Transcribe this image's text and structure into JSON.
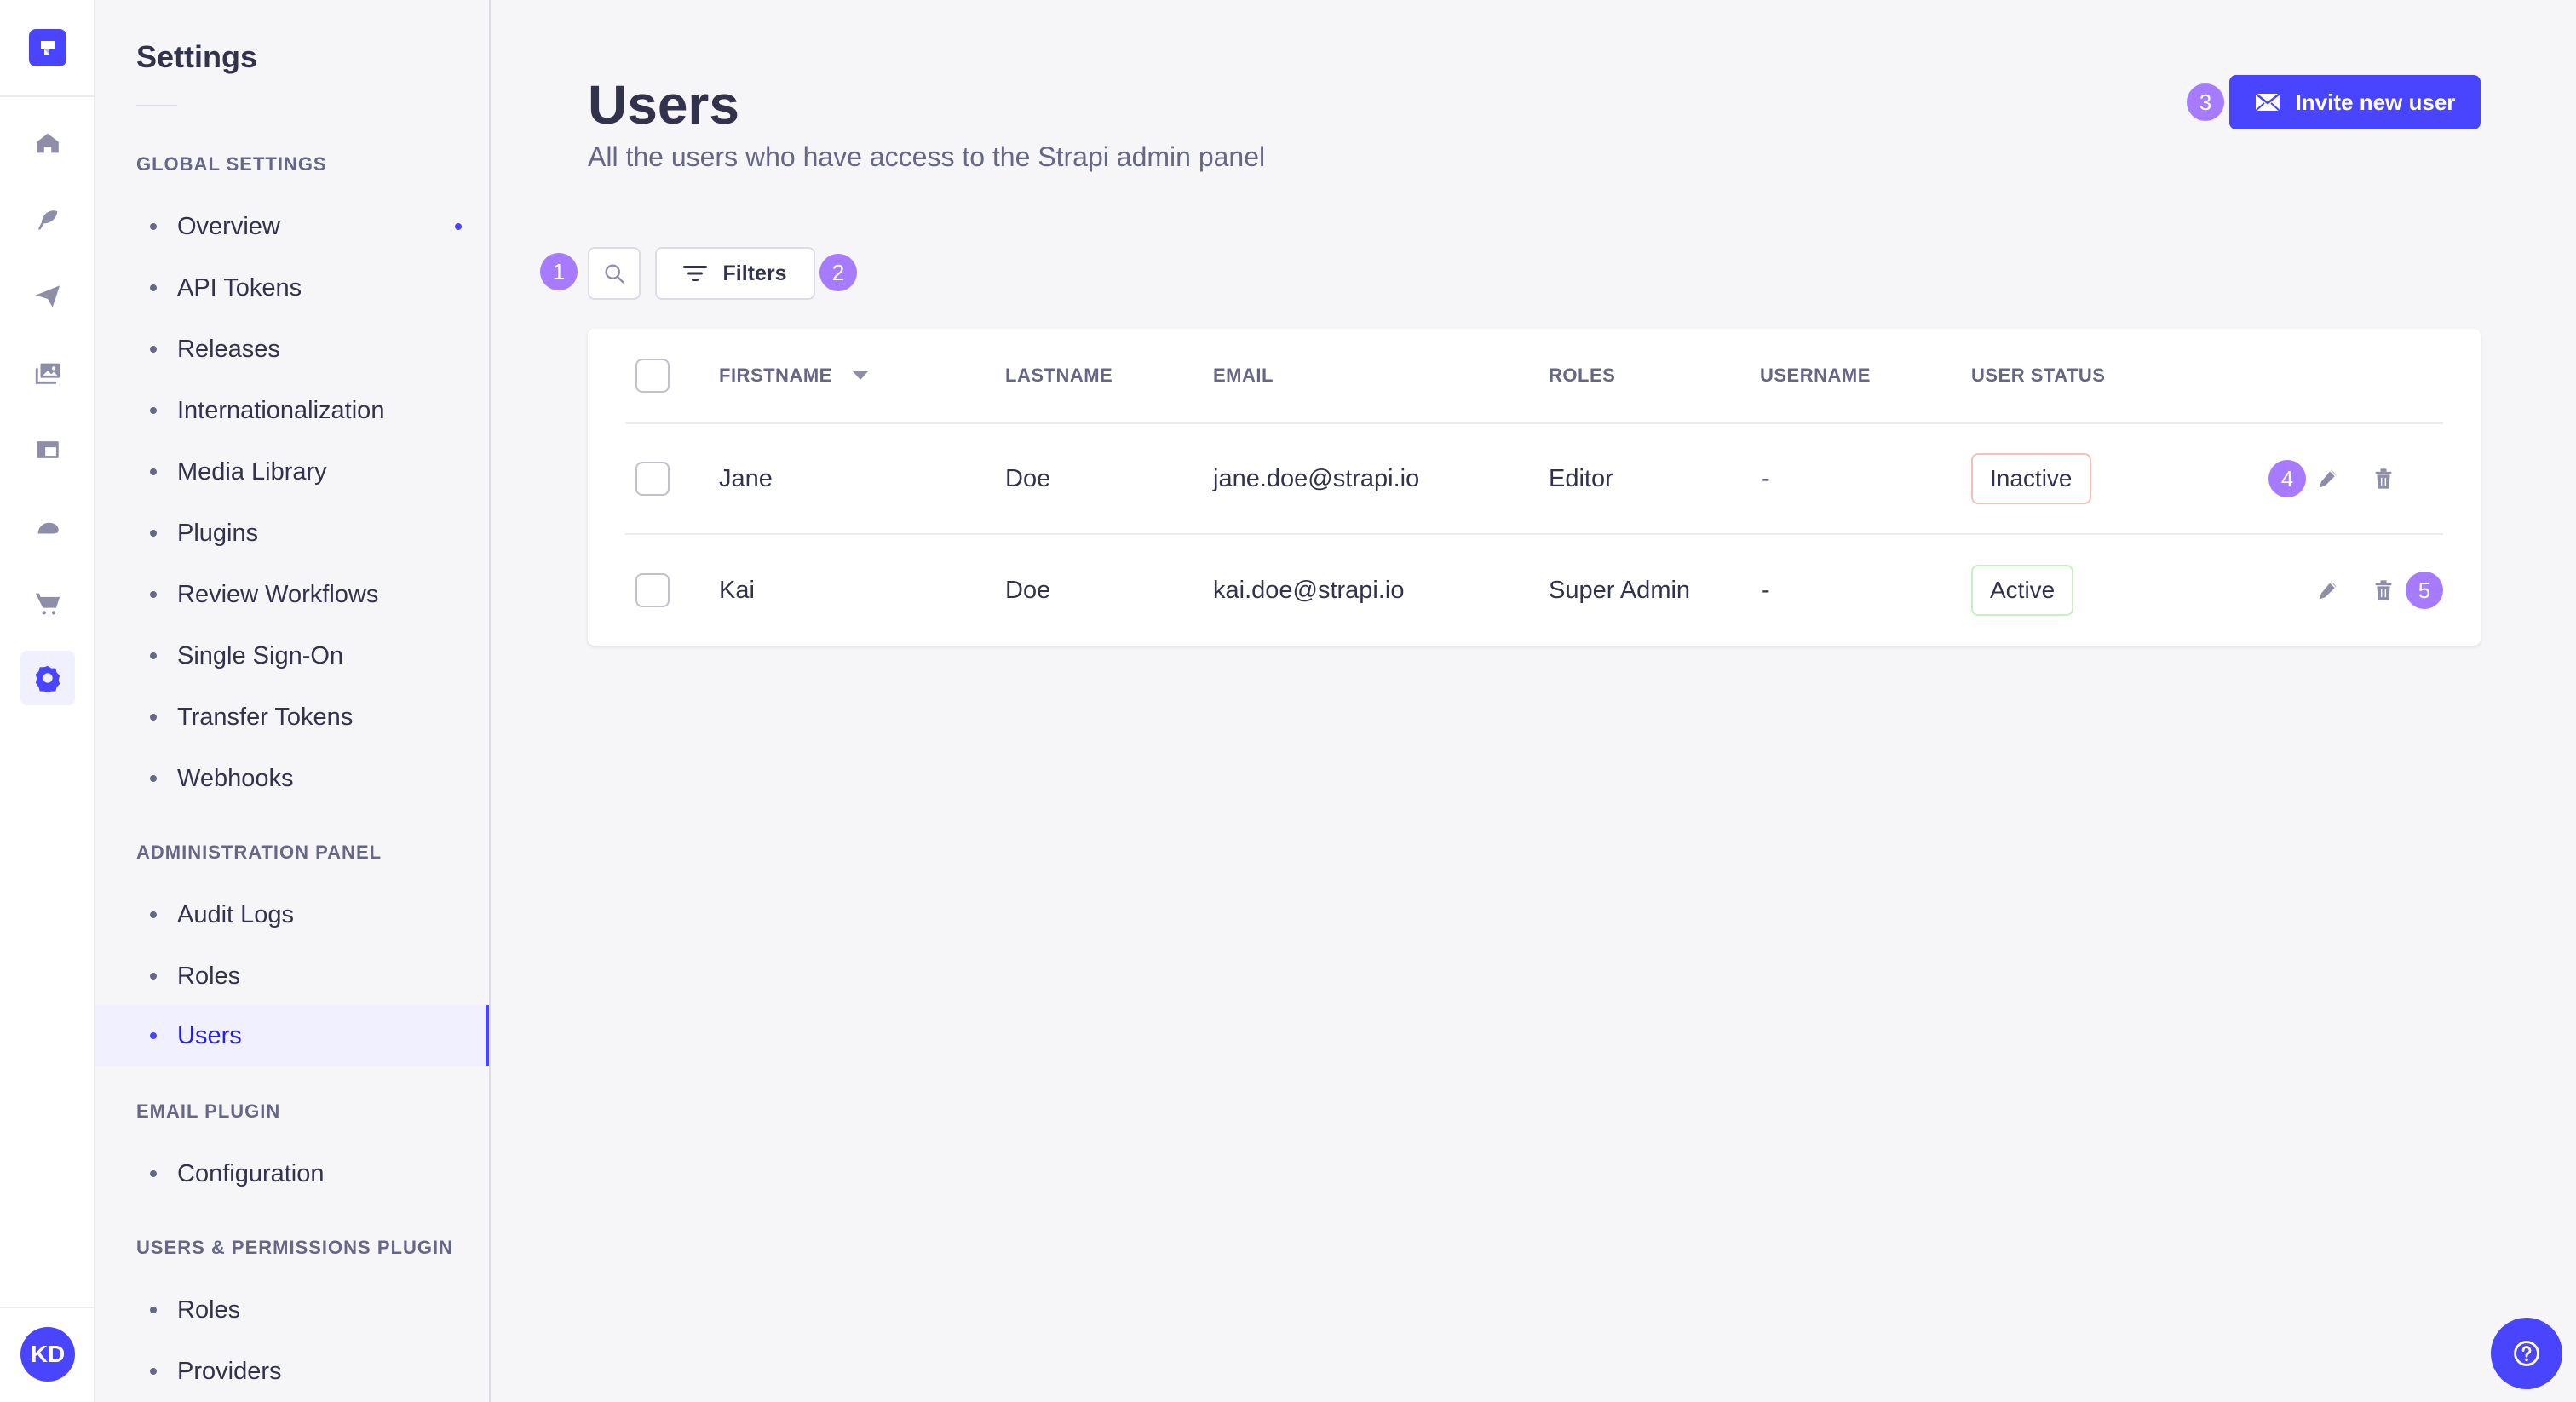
{
  "rail": {
    "items": [
      {
        "name": "home",
        "icon": "home-icon"
      },
      {
        "name": "content-manager",
        "icon": "feather-icon"
      },
      {
        "name": "releases",
        "icon": "paper-plane-icon"
      },
      {
        "name": "media-library",
        "icon": "images-icon"
      },
      {
        "name": "content-type-builder",
        "icon": "layout-icon"
      },
      {
        "name": "deploy",
        "icon": "cloud-icon"
      },
      {
        "name": "marketplace",
        "icon": "cart-icon"
      },
      {
        "name": "settings",
        "icon": "cog-icon",
        "active": true
      }
    ],
    "avatar_initials": "KD"
  },
  "subnav": {
    "title": "Settings",
    "sections": [
      {
        "label": "Global Settings",
        "items": [
          "Overview",
          "API Tokens",
          "Releases",
          "Internationalization",
          "Media Library",
          "Plugins",
          "Review Workflows",
          "Single Sign-On",
          "Transfer Tokens",
          "Webhooks"
        ]
      },
      {
        "label": "Administration Panel",
        "items": [
          "Audit Logs",
          "Roles",
          "Users"
        ]
      },
      {
        "label": "Email Plugin",
        "items": [
          "Configuration"
        ]
      },
      {
        "label": "Users & Permissions Plugin",
        "items": [
          "Roles",
          "Providers"
        ]
      }
    ],
    "active_item": "Users"
  },
  "header": {
    "title": "Users",
    "subtitle": "All the users who have access to the Strapi admin panel",
    "invite_button": "Invite new user"
  },
  "toolbar": {
    "filters_label": "Filters"
  },
  "annotations": [
    "1",
    "2",
    "3",
    "4",
    "5"
  ],
  "table": {
    "columns": [
      "Firstname",
      "Lastname",
      "Email",
      "Roles",
      "Username",
      "User Status"
    ],
    "sorted_column": "Firstname",
    "sort_direction": "desc",
    "rows": [
      {
        "firstname": "Jane",
        "lastname": "Doe",
        "email": "jane.doe@strapi.io",
        "roles": "Editor",
        "username": "-",
        "status": "Inactive"
      },
      {
        "firstname": "Kai",
        "lastname": "Doe",
        "email": "kai.doe@strapi.io",
        "roles": "Super Admin",
        "username": "-",
        "status": "Active"
      }
    ]
  },
  "colors": {
    "primary": "#4945ff",
    "annotation": "#a77bff",
    "inactive_border": "#f5c0b8",
    "active_border": "#c6f0c2"
  }
}
